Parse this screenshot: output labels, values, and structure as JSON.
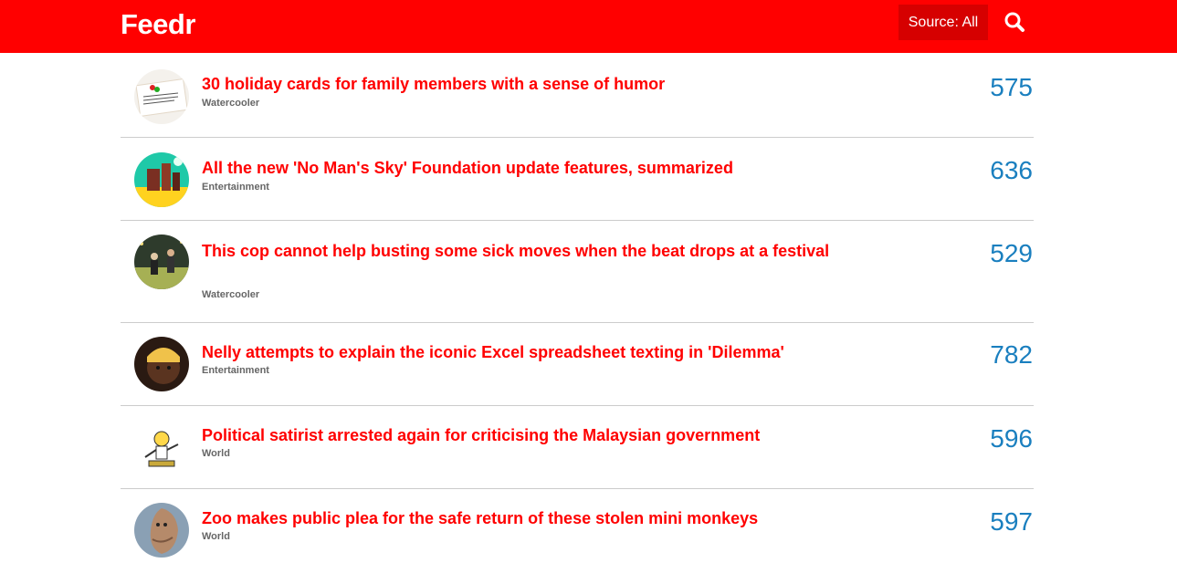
{
  "header": {
    "logo": "Feedr",
    "source_label": "Source: All",
    "search_icon": "search-icon"
  },
  "colors": {
    "brand": "#ff0000",
    "source_button_bg": "#d60000",
    "count": "#1a7fbf",
    "category": "#666666"
  },
  "articles": [
    {
      "title": "30 holiday cards for family members with a sense of humor",
      "category": "Watercooler",
      "count": "575",
      "image": "holiday-card-thumbnail"
    },
    {
      "title": "All the new 'No Man's Sky' Foundation update features, summarized",
      "category": "Entertainment",
      "count": "636",
      "image": "game-scene-thumbnail"
    },
    {
      "title": "This cop cannot help busting some sick moves when the beat drops at a festival",
      "category": "Watercooler",
      "count": "529",
      "image": "festival-thumbnail"
    },
    {
      "title": "Nelly attempts to explain the iconic Excel spreadsheet texting in 'Dilemma'",
      "category": "Entertainment",
      "count": "782",
      "image": "portrait-thumbnail"
    },
    {
      "title": "Political satirist arrested again for criticising the Malaysian government",
      "category": "World",
      "count": "596",
      "image": "cartoon-thumbnail"
    },
    {
      "title": "Zoo makes public plea for the safe return of these stolen mini monkeys",
      "category": "World",
      "count": "597",
      "image": "monkey-thumbnail"
    }
  ]
}
